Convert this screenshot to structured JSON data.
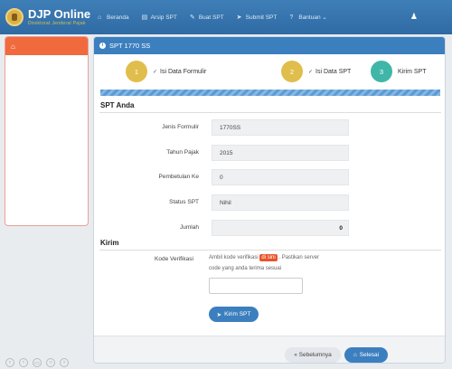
{
  "brand": {
    "title": "DJP Online",
    "subtitle": "Direktorat Jenderal Pajak"
  },
  "nav": [
    {
      "icon": "⌂",
      "label": "Beranda"
    },
    {
      "icon": "▤",
      "label": "Arsip SPT"
    },
    {
      "icon": "✎",
      "label": "Buat SPT"
    },
    {
      "icon": "➤",
      "label": "Submit SPT"
    },
    {
      "icon": "?",
      "label": "Bantuan ⌄"
    }
  ],
  "user_icon": "♟",
  "panel": {
    "title": "SPT 1770 SS"
  },
  "steps": [
    {
      "num": "1",
      "label": "Isi Data Formulir",
      "check": "✓"
    },
    {
      "num": "2",
      "label": "Isi Data SPT",
      "check": "✓"
    },
    {
      "num": "3",
      "label": "Kirim SPT",
      "check": ""
    }
  ],
  "section_spt": "SPT Anda",
  "fields": [
    {
      "label": "Jenis Formulir",
      "value": "1770SS"
    },
    {
      "label": "Tahun Pajak",
      "value": "2015"
    },
    {
      "label": "Pembetulan Ke",
      "value": "0"
    },
    {
      "label": "Status SPT",
      "value": "Nihil"
    },
    {
      "label": "Jumlah",
      "value": "0"
    }
  ],
  "section_kirim": "Kirim",
  "verif": {
    "label": "Kode Verifikasi",
    "text_a": "Ambil kode verifikasi",
    "badge": "di sini",
    "text_b": ". Pastikan server",
    "text_c": "code yang anda terima sesuai"
  },
  "buttons": {
    "kirim": "Kirim SPT",
    "prev": "« Sebelumnya",
    "done": "Selesai"
  }
}
